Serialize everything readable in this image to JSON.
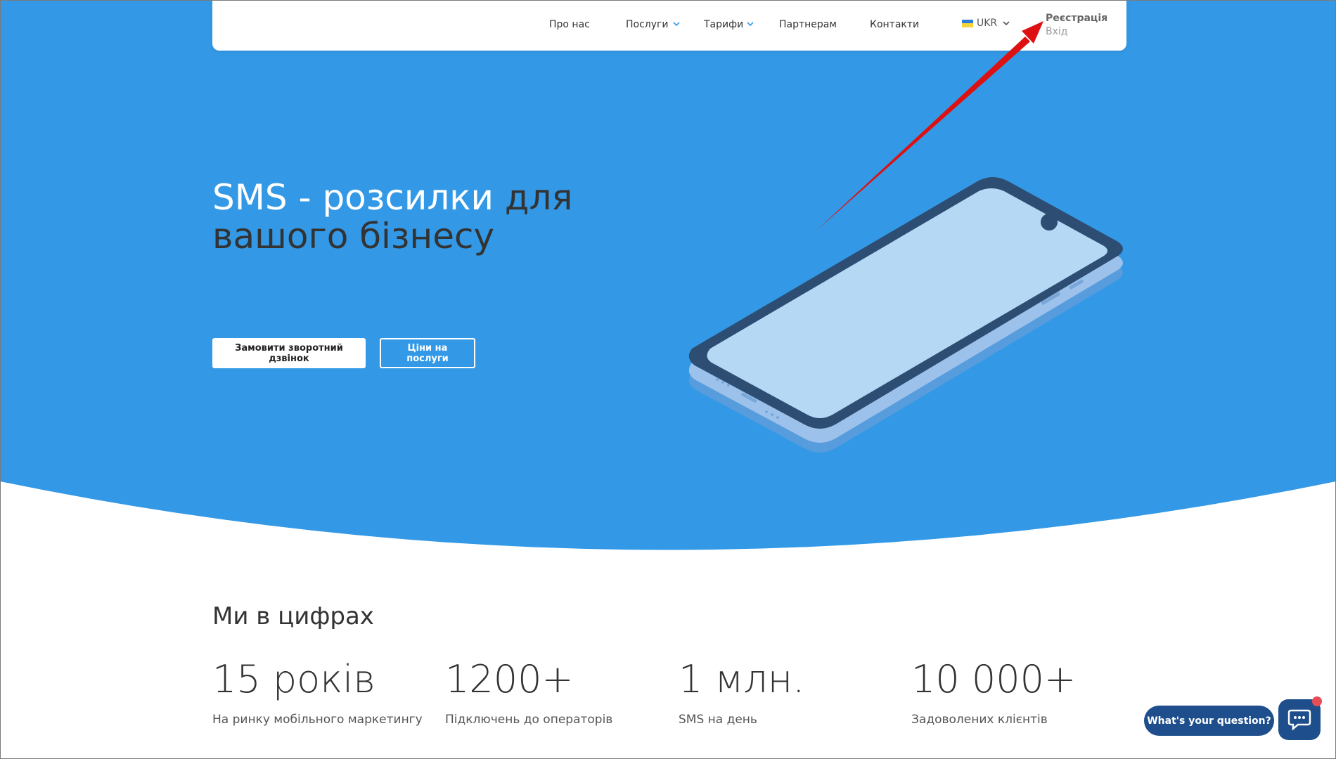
{
  "nav": {
    "items": [
      {
        "label": "Про нас",
        "dropdown": false
      },
      {
        "label": "Послуги",
        "dropdown": true
      },
      {
        "label": "Тарифи",
        "dropdown": true
      },
      {
        "label": "Партнерам",
        "dropdown": false
      },
      {
        "label": "Контакти",
        "dropdown": false
      }
    ],
    "lang": "UKR",
    "register": "Реєстрація",
    "login": "Вхід"
  },
  "hero": {
    "title_white": "SMS - розсилки",
    "title_dark_1": "для",
    "title_dark_2": "вашого бізнесу",
    "btn_callback": "Замовити зворотний дзвінок",
    "btn_prices": "Ціни на послуги"
  },
  "stats": {
    "title": "Ми в цифрах",
    "items": [
      {
        "value": "15 років",
        "label": "На ринку мобільного маркетингу"
      },
      {
        "value": "1200+",
        "label": "Підключень до операторів"
      },
      {
        "value": "1 млн.",
        "label": "SMS на день"
      },
      {
        "value": "10 000+",
        "label": "Задоволених клієнтів"
      }
    ]
  },
  "chat": {
    "prompt": "What's your question?"
  },
  "colors": {
    "hero_blue": "#3399e6",
    "dark_text": "#333333",
    "chat_blue": "#1e4f8c",
    "annotation_arrow": "#dd1111"
  },
  "icons": [
    "chevron-down-icon",
    "ukraine-flag-icon",
    "phone-illustration",
    "chat-icon",
    "annotation-arrow"
  ]
}
